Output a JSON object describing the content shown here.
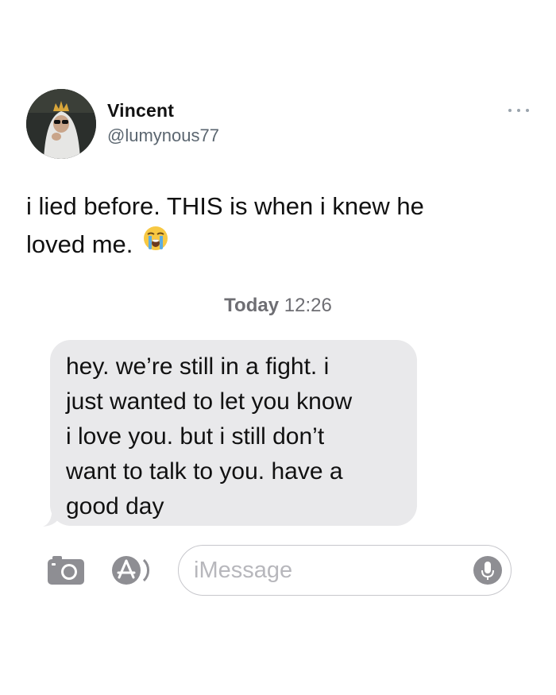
{
  "tweet": {
    "display_name": "Vincent",
    "handle": "@lumynous77",
    "more_icon": "more-horizontal-icon",
    "text_lines": [
      "i lied before. THIS is when i knew he",
      "loved me."
    ],
    "emoji": "loudly-crying-face-icon"
  },
  "conversation": {
    "timestamp_day": "Today",
    "timestamp_time": "12:26",
    "received_message_lines": [
      "hey. we’re still in a fight. i",
      "just wanted to let you know",
      "i love you. but i still don’t",
      "want to talk to you. have a",
      "good day"
    ]
  },
  "input_bar": {
    "camera_icon": "camera-icon",
    "apps_icon": "app-store-icon",
    "placeholder": "iMessage",
    "mic_icon": "microphone-icon"
  },
  "colors": {
    "bubble_received": "#e9e9eb",
    "handle_gray": "#5b6670",
    "placeholder_gray": "#b7b7bc",
    "icon_gray": "#8e8e93"
  }
}
